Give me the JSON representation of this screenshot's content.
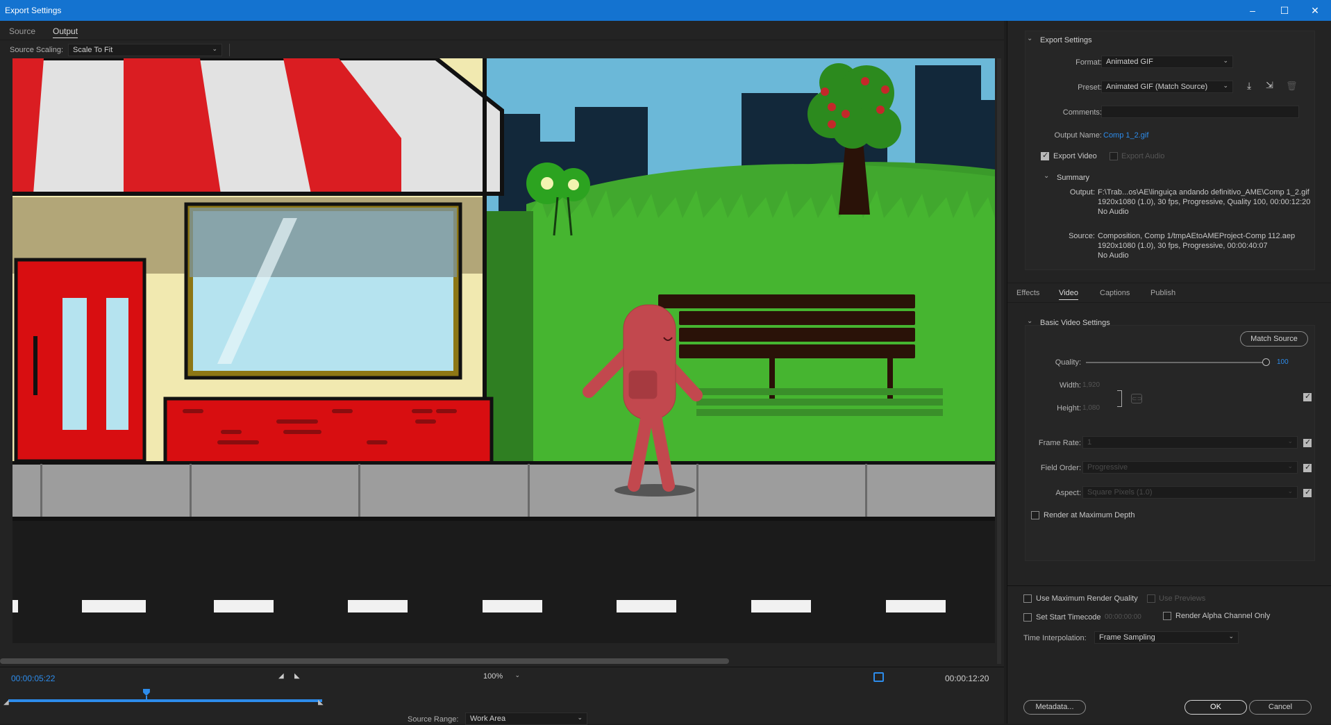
{
  "window": {
    "title": "Export Settings"
  },
  "left": {
    "tabs": [
      "Source",
      "Output"
    ],
    "source_scaling_label": "Source Scaling:",
    "source_scaling_value": "Scale To Fit",
    "timecode_current": "00:00:05:22",
    "timecode_end": "00:00:12:20",
    "zoom": "100%",
    "source_range_label": "Source Range:",
    "source_range_value": "Work Area",
    "playhead_fraction": 0.44
  },
  "right": {
    "export_settings_title": "Export Settings",
    "format_label": "Format:",
    "format_value": "Animated GIF",
    "preset_label": "Preset:",
    "preset_value": "Animated GIF (Match Source)",
    "comments_label": "Comments:",
    "output_name_label": "Output Name:",
    "output_name_value": "Comp 1_2.gif",
    "export_video_label": "Export Video",
    "export_audio_label": "Export Audio",
    "summary_title": "Summary",
    "summary_output_label": "Output:",
    "summary_output_lines": [
      "F:\\Trab...os\\AE\\linguiça andando definitivo_AME\\Comp 1_2.gif",
      "1920x1080 (1.0), 30 fps, Progressive, Quality 100, 00:00:12:20",
      "No Audio"
    ],
    "summary_source_label": "Source:",
    "summary_source_lines": [
      "Composition, Comp 1/tmpAEtoAMEProject-Comp 112.aep",
      "1920x1080 (1.0), 30 fps, Progressive, 00:00:40:07",
      "No Audio"
    ],
    "tabs": [
      "Effects",
      "Video",
      "Captions",
      "Publish"
    ],
    "basic_video_title": "Basic Video Settings",
    "match_source_label": "Match Source",
    "quality_label": "Quality:",
    "quality_value": "100",
    "width_label": "Width:",
    "width_value": "1,920",
    "height_label": "Height:",
    "height_value": "1,080",
    "frame_rate_label": "Frame Rate:",
    "frame_rate_value": "1",
    "field_order_label": "Field Order:",
    "field_order_value": "Progressive",
    "aspect_label": "Aspect:",
    "aspect_value": "Square Pixels (1.0)",
    "render_max_depth_label": "Render at Maximum Depth",
    "use_max_render_quality_label": "Use Maximum Render Quality",
    "use_previews_label": "Use Previews",
    "set_start_timecode_label": "Set Start Timecode",
    "start_timecode_value": "00:00:00:00",
    "render_alpha_label": "Render Alpha Channel Only",
    "time_interp_label": "Time Interpolation:",
    "time_interp_value": "Frame Sampling",
    "metadata_label": "Metadata...",
    "ok_label": "OK",
    "cancel_label": "Cancel"
  },
  "colors": {
    "accent": "#1473d0",
    "link": "#2d8ceb"
  }
}
